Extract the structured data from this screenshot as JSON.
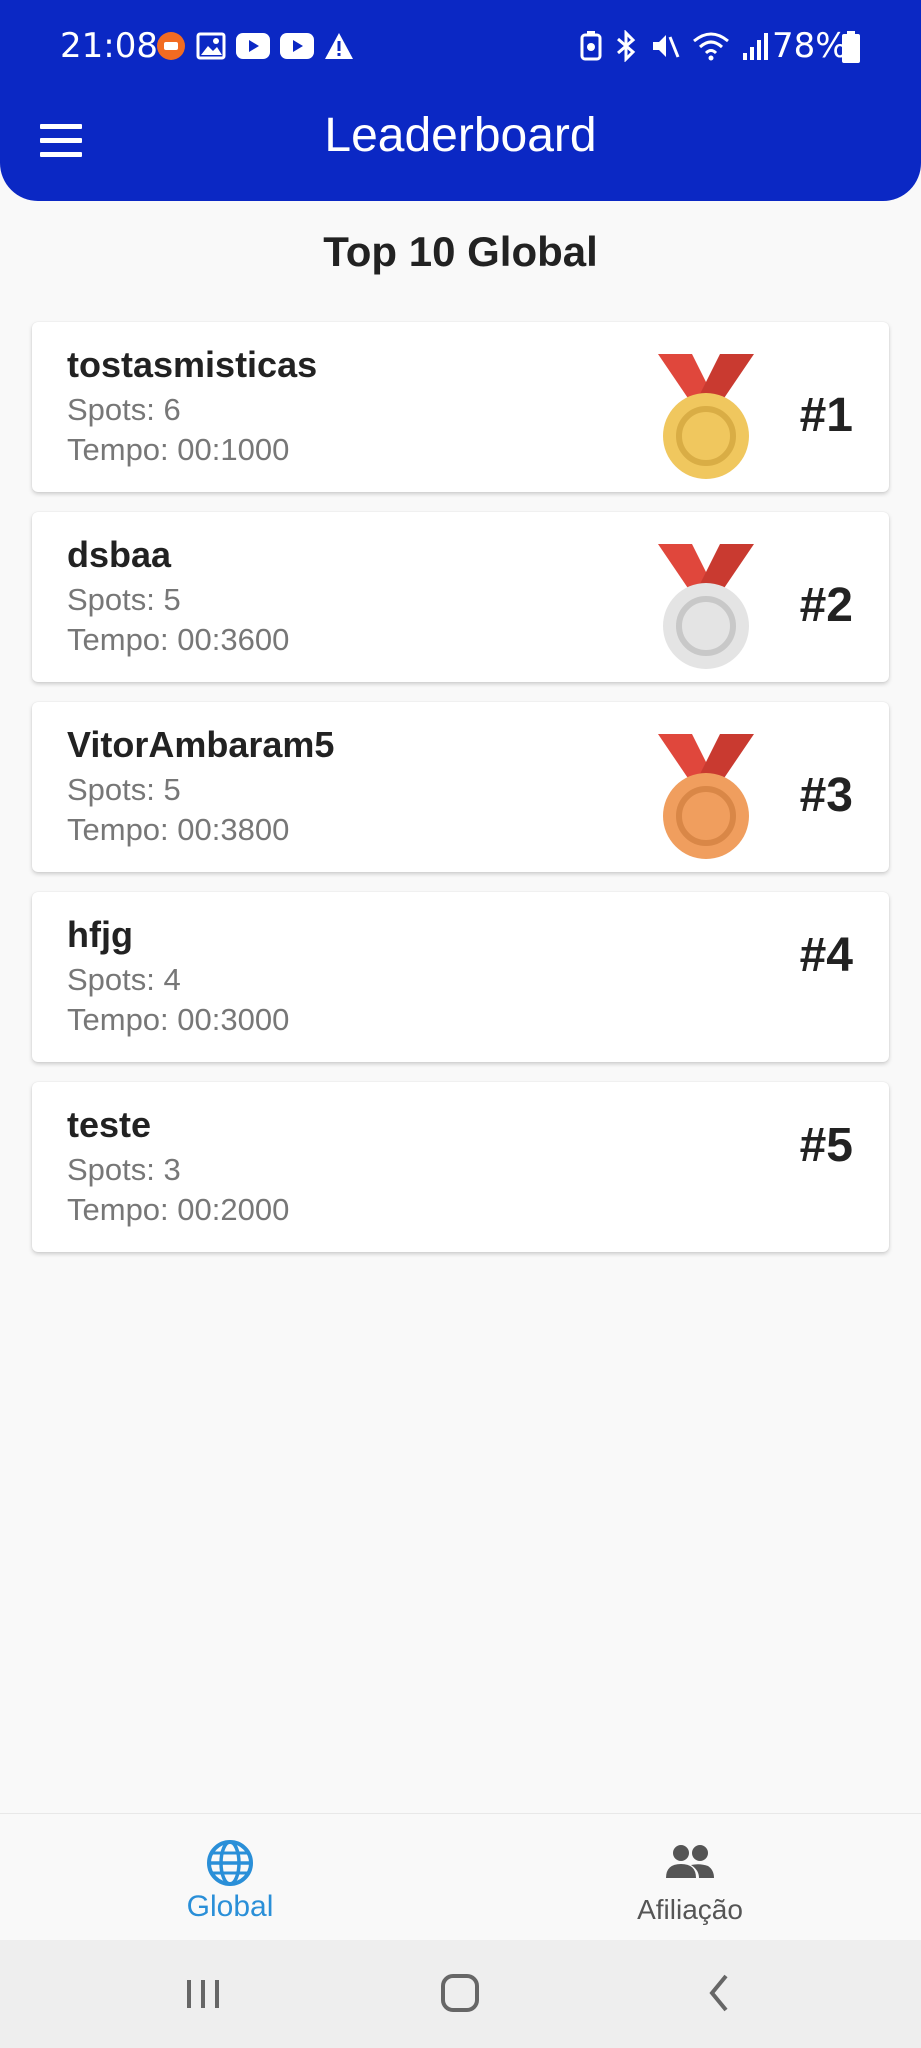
{
  "status_bar": {
    "time": "21:08",
    "battery": "78%",
    "icons": [
      "app-notification-icon",
      "image-icon",
      "youtube-icon",
      "youtube-icon",
      "warning-icon",
      "battery-saver-icon",
      "bluetooth-icon",
      "mute-icon",
      "wifi-icon",
      "signal-icon",
      "battery-icon"
    ]
  },
  "app_bar": {
    "title": "Leaderboard",
    "menu_icon": "menu-icon"
  },
  "section_title": "Top 10 Global",
  "entries": [
    {
      "name": "tostasmisticas",
      "spots": "Spots: 6",
      "tempo": "Tempo: 00:1000",
      "rank": "#1",
      "medal": "gold"
    },
    {
      "name": "dsbaa",
      "spots": "Spots: 5",
      "tempo": "Tempo: 00:3600",
      "rank": "#2",
      "medal": "silver"
    },
    {
      "name": "VitorAmbaram5",
      "spots": "Spots: 5",
      "tempo": "Tempo: 00:3800",
      "rank": "#3",
      "medal": "bronze"
    },
    {
      "name": "hfjg",
      "spots": "Spots: 4",
      "tempo": "Tempo: 00:3000",
      "rank": "#4",
      "medal": ""
    },
    {
      "name": "teste",
      "spots": "Spots: 3",
      "tempo": "Tempo: 00:2000",
      "rank": "#5",
      "medal": ""
    }
  ],
  "bottom_nav": {
    "items": [
      {
        "label": "Global",
        "icon": "globe-icon",
        "active": true
      },
      {
        "label": "Afiliação",
        "icon": "people-icon",
        "active": false
      }
    ]
  },
  "colors": {
    "app_bar": "#0b28c4",
    "active_tab": "#2a8fd8",
    "inactive_tab": "#555555",
    "gold": "#f0c75e",
    "silver": "#e4e4e4",
    "bronze": "#f09e5e",
    "ribbon": "#e0473c"
  }
}
